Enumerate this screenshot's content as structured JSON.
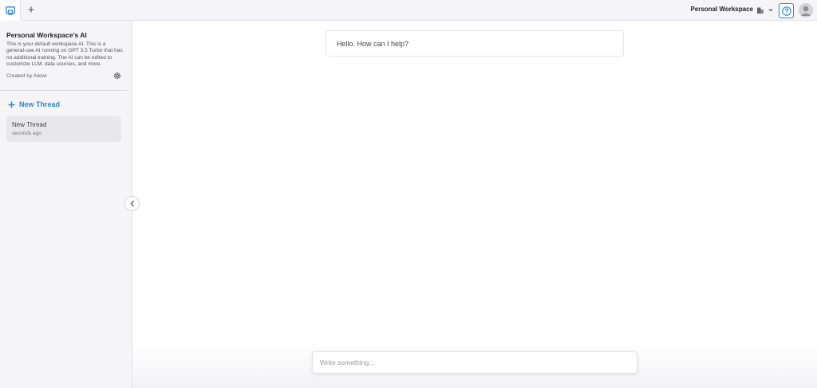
{
  "topbar": {
    "workspace_name": "Personal Workspace",
    "new_tab_label": "+"
  },
  "sidebar": {
    "ai_title": "Personal Workspace's AI",
    "ai_description": "This is your default workspace AI. This is a general-use AI running on GPT 3.5 Turbo that has no additional training. The AI can be edited to customize LLM, data sources, and more.",
    "created_by": "Created by Aikiwi",
    "new_thread_label": "New Thread",
    "threads": [
      {
        "title": "New Thread",
        "time": "seconds ago"
      }
    ]
  },
  "chat": {
    "greeting": "Hello. How can I help?",
    "input_placeholder": "Write something..."
  },
  "colors": {
    "accent": "#2a86d8",
    "sidebar_bg": "#f5f5f7",
    "thread_active_bg": "#e8e8ea"
  }
}
